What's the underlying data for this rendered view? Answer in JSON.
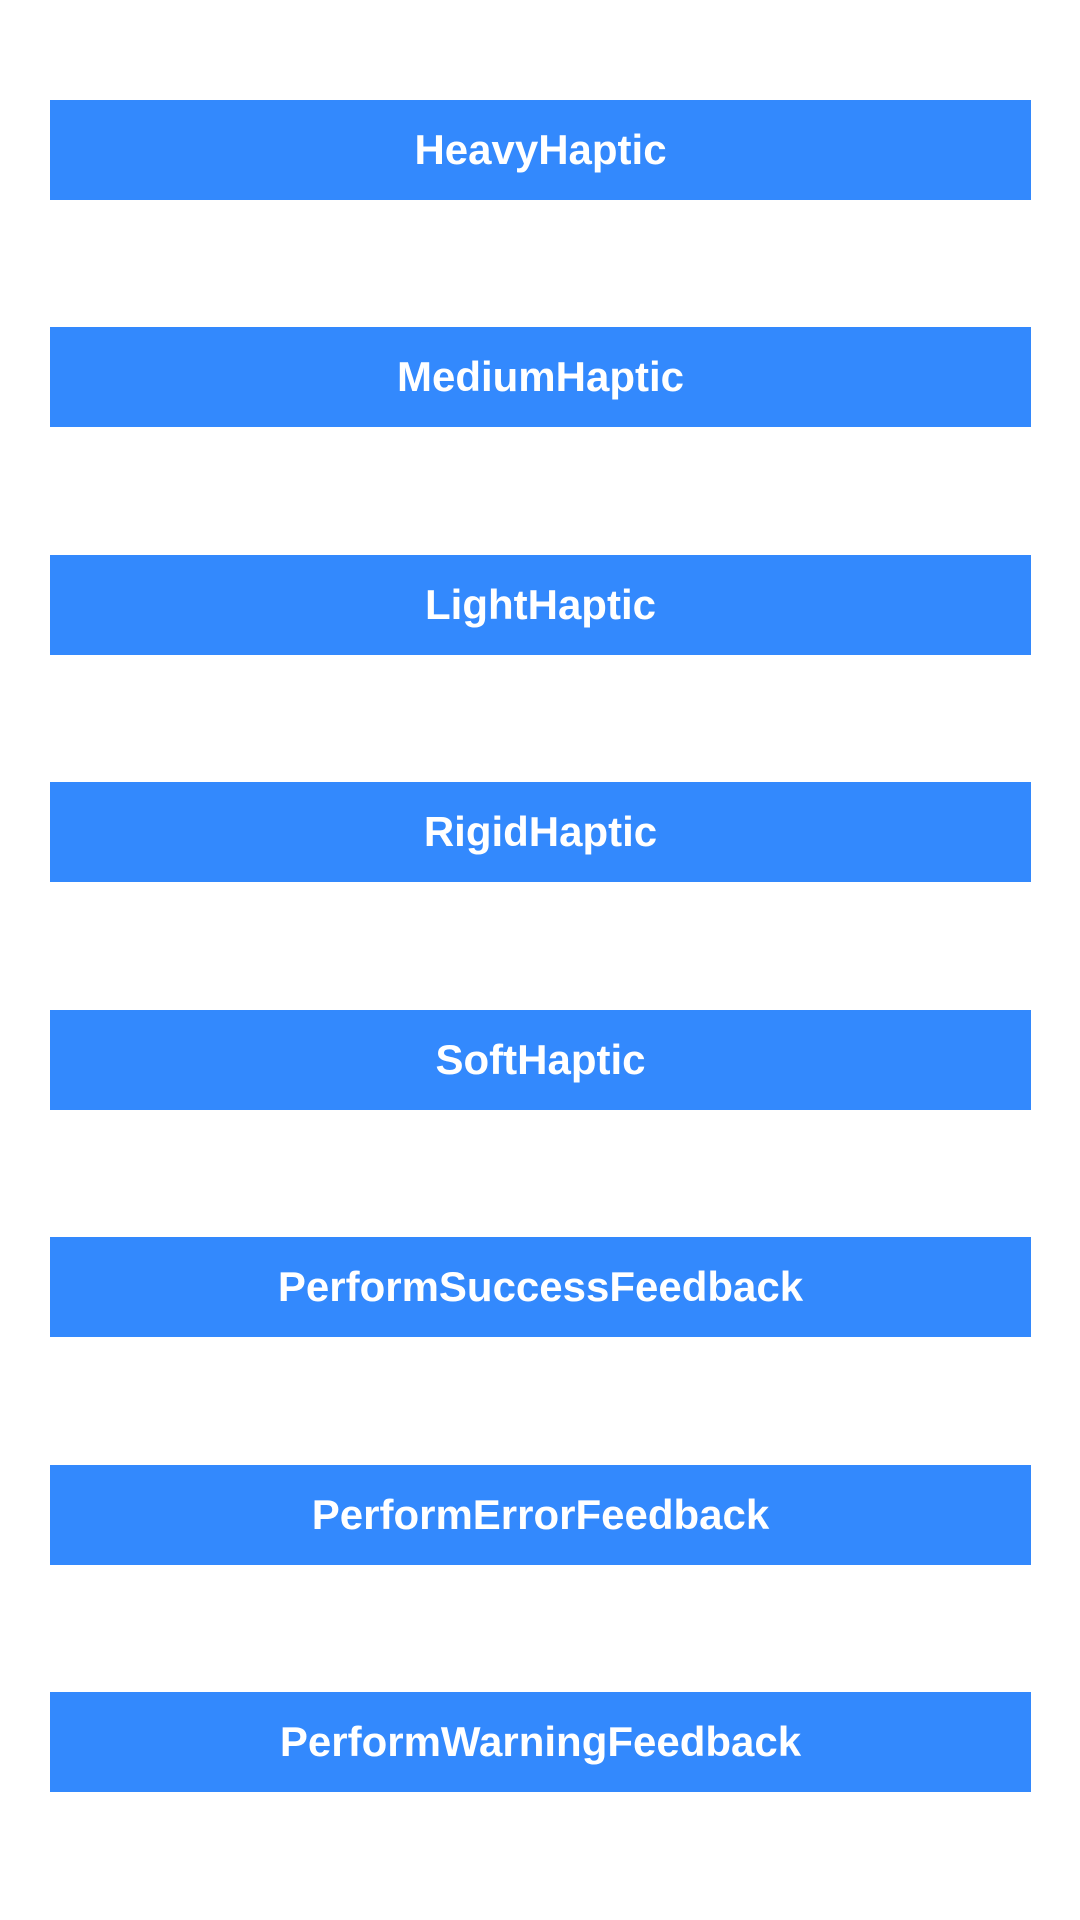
{
  "colors": {
    "background": "#ffffff",
    "button_background": "#3389fd",
    "button_text": "#ffffff"
  },
  "buttons": [
    {
      "label": "HeavyHaptic"
    },
    {
      "label": "MediumHaptic"
    },
    {
      "label": "LightHaptic"
    },
    {
      "label": "RigidHaptic"
    },
    {
      "label": "SoftHaptic"
    },
    {
      "label": "PerformSuccessFeedback"
    },
    {
      "label": "PerformErrorFeedback"
    },
    {
      "label": "PerformWarningFeedback"
    }
  ]
}
